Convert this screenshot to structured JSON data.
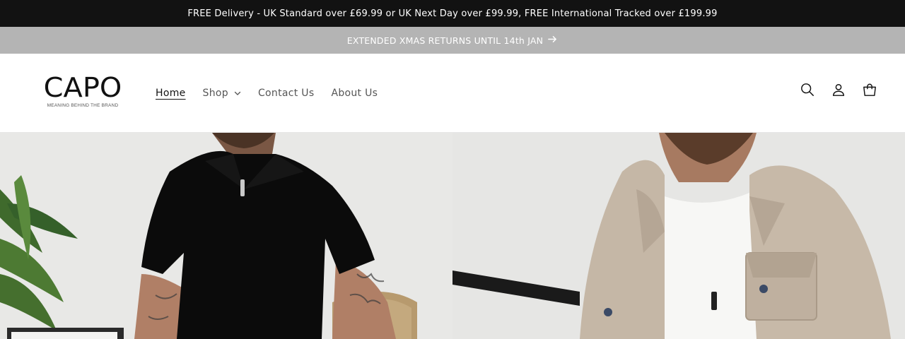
{
  "announcement": {
    "delivery_text": "FREE Delivery - UK Standard over £69.99 or UK Next Day over £99.99, FREE International Tracked over £199.99",
    "returns_text": "EXTENDED XMAS RETURNS UNTIL 14th JAN",
    "returns_icon": "arrow-right-icon"
  },
  "brand": {
    "name": "CAPO",
    "tagline": "MEANING BEHIND THE BRAND"
  },
  "nav": {
    "items": [
      {
        "label": "Home",
        "active": true
      },
      {
        "label": "Shop",
        "has_dropdown": true
      },
      {
        "label": "Contact Us"
      },
      {
        "label": "About Us"
      }
    ]
  },
  "header_icons": [
    "search-icon",
    "account-icon",
    "cart-icon"
  ],
  "colors": {
    "topbar_bg": "#121212",
    "returns_bg": "#b4b4b4",
    "text": "#121212"
  }
}
